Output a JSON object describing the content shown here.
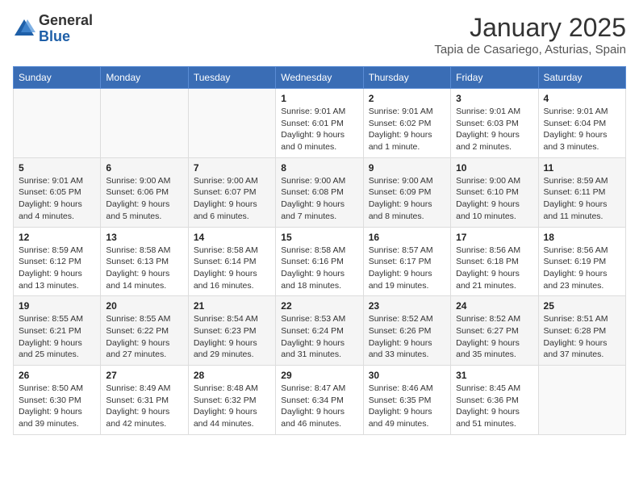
{
  "header": {
    "logo_general": "General",
    "logo_blue": "Blue",
    "month_title": "January 2025",
    "location": "Tapia de Casariego, Asturias, Spain"
  },
  "days_of_week": [
    "Sunday",
    "Monday",
    "Tuesday",
    "Wednesday",
    "Thursday",
    "Friday",
    "Saturday"
  ],
  "weeks": [
    [
      {
        "day": "",
        "info": ""
      },
      {
        "day": "",
        "info": ""
      },
      {
        "day": "",
        "info": ""
      },
      {
        "day": "1",
        "info": "Sunrise: 9:01 AM\nSunset: 6:01 PM\nDaylight: 9 hours\nand 0 minutes."
      },
      {
        "day": "2",
        "info": "Sunrise: 9:01 AM\nSunset: 6:02 PM\nDaylight: 9 hours\nand 1 minute."
      },
      {
        "day": "3",
        "info": "Sunrise: 9:01 AM\nSunset: 6:03 PM\nDaylight: 9 hours\nand 2 minutes."
      },
      {
        "day": "4",
        "info": "Sunrise: 9:01 AM\nSunset: 6:04 PM\nDaylight: 9 hours\nand 3 minutes."
      }
    ],
    [
      {
        "day": "5",
        "info": "Sunrise: 9:01 AM\nSunset: 6:05 PM\nDaylight: 9 hours\nand 4 minutes."
      },
      {
        "day": "6",
        "info": "Sunrise: 9:00 AM\nSunset: 6:06 PM\nDaylight: 9 hours\nand 5 minutes."
      },
      {
        "day": "7",
        "info": "Sunrise: 9:00 AM\nSunset: 6:07 PM\nDaylight: 9 hours\nand 6 minutes."
      },
      {
        "day": "8",
        "info": "Sunrise: 9:00 AM\nSunset: 6:08 PM\nDaylight: 9 hours\nand 7 minutes."
      },
      {
        "day": "9",
        "info": "Sunrise: 9:00 AM\nSunset: 6:09 PM\nDaylight: 9 hours\nand 8 minutes."
      },
      {
        "day": "10",
        "info": "Sunrise: 9:00 AM\nSunset: 6:10 PM\nDaylight: 9 hours\nand 10 minutes."
      },
      {
        "day": "11",
        "info": "Sunrise: 8:59 AM\nSunset: 6:11 PM\nDaylight: 9 hours\nand 11 minutes."
      }
    ],
    [
      {
        "day": "12",
        "info": "Sunrise: 8:59 AM\nSunset: 6:12 PM\nDaylight: 9 hours\nand 13 minutes."
      },
      {
        "day": "13",
        "info": "Sunrise: 8:58 AM\nSunset: 6:13 PM\nDaylight: 9 hours\nand 14 minutes."
      },
      {
        "day": "14",
        "info": "Sunrise: 8:58 AM\nSunset: 6:14 PM\nDaylight: 9 hours\nand 16 minutes."
      },
      {
        "day": "15",
        "info": "Sunrise: 8:58 AM\nSunset: 6:16 PM\nDaylight: 9 hours\nand 18 minutes."
      },
      {
        "day": "16",
        "info": "Sunrise: 8:57 AM\nSunset: 6:17 PM\nDaylight: 9 hours\nand 19 minutes."
      },
      {
        "day": "17",
        "info": "Sunrise: 8:56 AM\nSunset: 6:18 PM\nDaylight: 9 hours\nand 21 minutes."
      },
      {
        "day": "18",
        "info": "Sunrise: 8:56 AM\nSunset: 6:19 PM\nDaylight: 9 hours\nand 23 minutes."
      }
    ],
    [
      {
        "day": "19",
        "info": "Sunrise: 8:55 AM\nSunset: 6:21 PM\nDaylight: 9 hours\nand 25 minutes."
      },
      {
        "day": "20",
        "info": "Sunrise: 8:55 AM\nSunset: 6:22 PM\nDaylight: 9 hours\nand 27 minutes."
      },
      {
        "day": "21",
        "info": "Sunrise: 8:54 AM\nSunset: 6:23 PM\nDaylight: 9 hours\nand 29 minutes."
      },
      {
        "day": "22",
        "info": "Sunrise: 8:53 AM\nSunset: 6:24 PM\nDaylight: 9 hours\nand 31 minutes."
      },
      {
        "day": "23",
        "info": "Sunrise: 8:52 AM\nSunset: 6:26 PM\nDaylight: 9 hours\nand 33 minutes."
      },
      {
        "day": "24",
        "info": "Sunrise: 8:52 AM\nSunset: 6:27 PM\nDaylight: 9 hours\nand 35 minutes."
      },
      {
        "day": "25",
        "info": "Sunrise: 8:51 AM\nSunset: 6:28 PM\nDaylight: 9 hours\nand 37 minutes."
      }
    ],
    [
      {
        "day": "26",
        "info": "Sunrise: 8:50 AM\nSunset: 6:30 PM\nDaylight: 9 hours\nand 39 minutes."
      },
      {
        "day": "27",
        "info": "Sunrise: 8:49 AM\nSunset: 6:31 PM\nDaylight: 9 hours\nand 42 minutes."
      },
      {
        "day": "28",
        "info": "Sunrise: 8:48 AM\nSunset: 6:32 PM\nDaylight: 9 hours\nand 44 minutes."
      },
      {
        "day": "29",
        "info": "Sunrise: 8:47 AM\nSunset: 6:34 PM\nDaylight: 9 hours\nand 46 minutes."
      },
      {
        "day": "30",
        "info": "Sunrise: 8:46 AM\nSunset: 6:35 PM\nDaylight: 9 hours\nand 49 minutes."
      },
      {
        "day": "31",
        "info": "Sunrise: 8:45 AM\nSunset: 6:36 PM\nDaylight: 9 hours\nand 51 minutes."
      },
      {
        "day": "",
        "info": ""
      }
    ]
  ]
}
